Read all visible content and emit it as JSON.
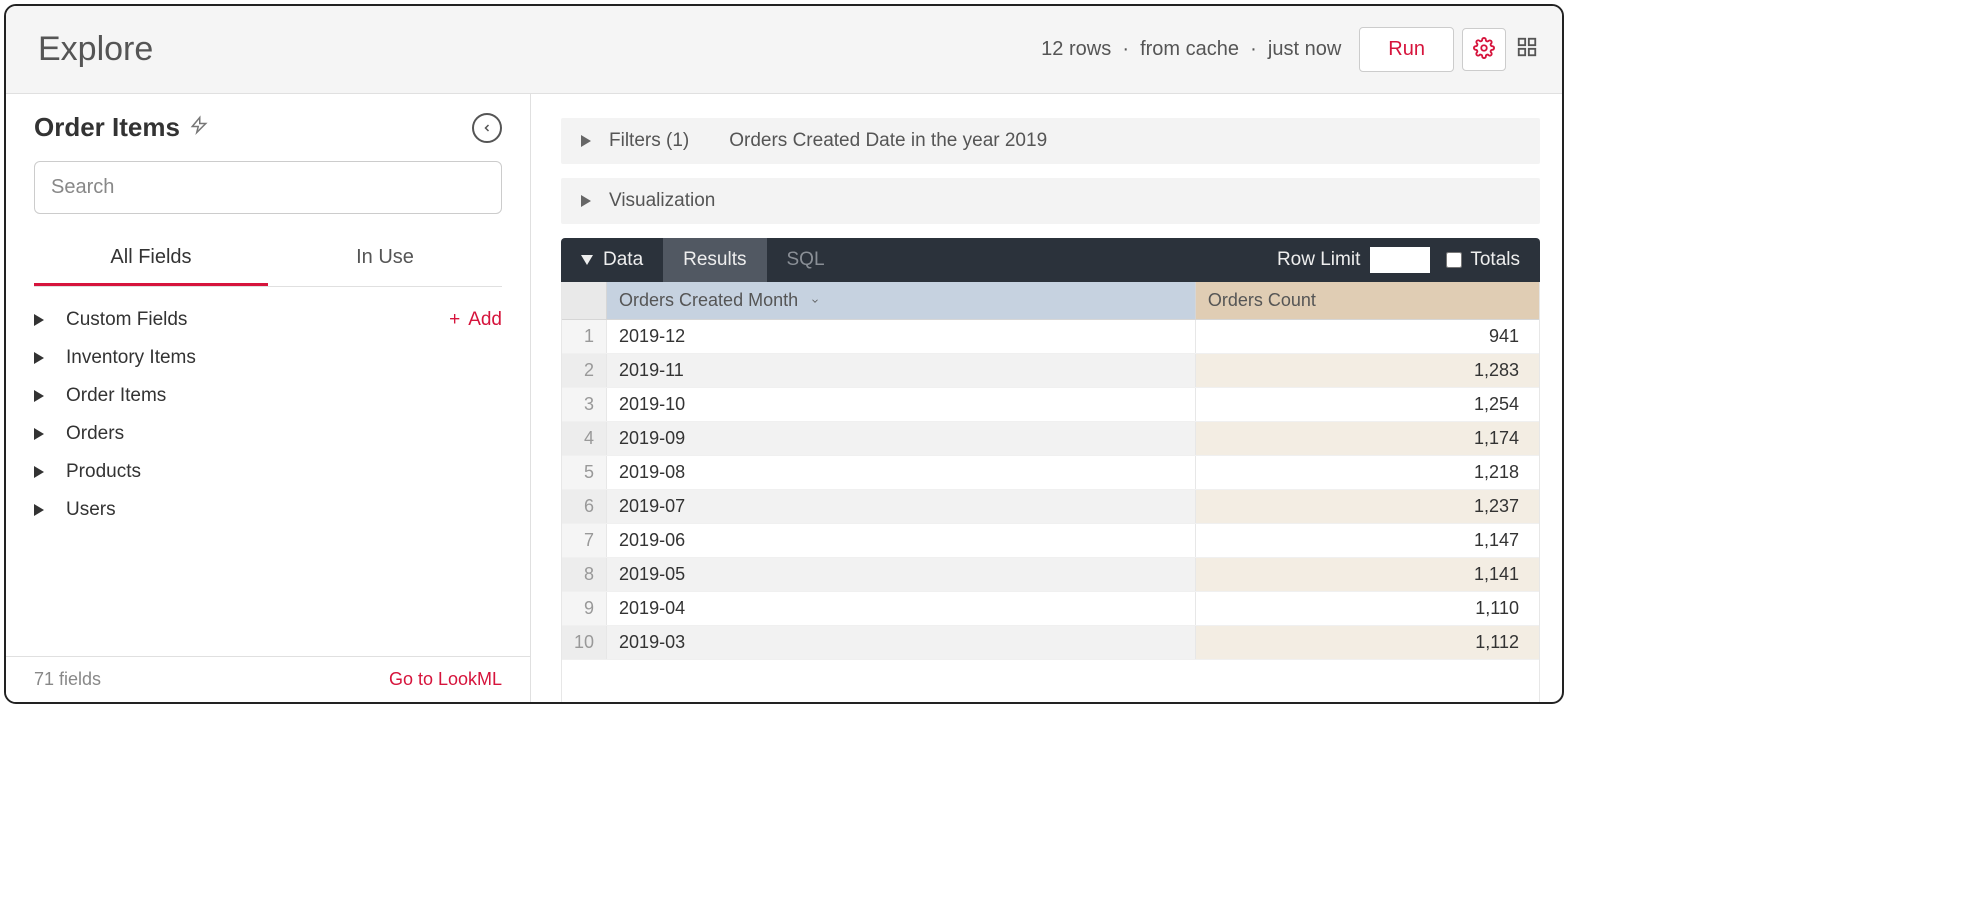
{
  "topbar": {
    "title": "Explore",
    "status_rows": "12 rows",
    "status_cache": "from cache",
    "status_time": "just now",
    "run_label": "Run"
  },
  "sidebar": {
    "title": "Order Items",
    "search_placeholder": "Search",
    "tabs": {
      "all": "All Fields",
      "inuse": "In Use"
    },
    "add_label": "Add",
    "groups": [
      "Custom Fields",
      "Inventory Items",
      "Order Items",
      "Orders",
      "Products",
      "Users"
    ],
    "footer": {
      "count": "71 fields",
      "link": "Go to LookML"
    }
  },
  "main": {
    "filters_label": "Filters (1)",
    "filters_desc": "Orders Created Date in the year 2019",
    "vis_label": "Visualization",
    "databar": {
      "data": "Data",
      "results": "Results",
      "sql": "SQL",
      "rowlimit_label": "Row Limit",
      "rowlimit_value": "",
      "totals_label": "Totals"
    },
    "columns": {
      "dim": "Orders Created Month",
      "meas": "Orders Count"
    },
    "rows": [
      {
        "n": "1",
        "month": "2019-12",
        "count": "941"
      },
      {
        "n": "2",
        "month": "2019-11",
        "count": "1,283"
      },
      {
        "n": "3",
        "month": "2019-10",
        "count": "1,254"
      },
      {
        "n": "4",
        "month": "2019-09",
        "count": "1,174"
      },
      {
        "n": "5",
        "month": "2019-08",
        "count": "1,218"
      },
      {
        "n": "6",
        "month": "2019-07",
        "count": "1,237"
      },
      {
        "n": "7",
        "month": "2019-06",
        "count": "1,147"
      },
      {
        "n": "8",
        "month": "2019-05",
        "count": "1,141"
      },
      {
        "n": "9",
        "month": "2019-04",
        "count": "1,110"
      },
      {
        "n": "10",
        "month": "2019-03",
        "count": "1,112"
      }
    ]
  }
}
